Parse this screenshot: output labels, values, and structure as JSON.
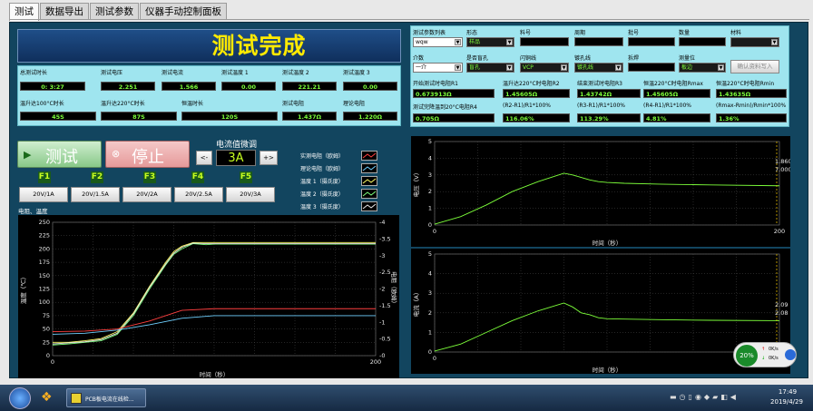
{
  "tabs": [
    "测试",
    "数据导出",
    "测试参数",
    "仪器手动控制面板"
  ],
  "banner": "测试完成",
  "params": {
    "labels": [
      "总测试时长",
      "测试电压",
      "测试电流",
      "测试温度 1",
      "测试温度 2",
      "测试温度 3"
    ],
    "values": [
      "0: 3:27",
      "2.251",
      "1.566",
      "0.00",
      "221.21",
      "0.00"
    ],
    "labels2": [
      "温升达100°C时长",
      "温升达220°C时长",
      "恒温时长",
      "测试电阻",
      "理论电阻"
    ],
    "values2": [
      "45S",
      "87S",
      "120S",
      "1.437Ω",
      "1.220Ω"
    ]
  },
  "right_panel": {
    "row1_labels": [
      "测试参数列表",
      "形态",
      "料号",
      "周期",
      "批号",
      "数量",
      "材料"
    ],
    "row1_values": [
      "wqw",
      "样品",
      "",
      "",
      "",
      "",
      ""
    ],
    "row2_labels": [
      "介数",
      "是否盲孔",
      "闪铜线",
      "镀孔线",
      "拆焊",
      "测量位"
    ],
    "row2_values": [
      "一介",
      "盲孔",
      "VCP",
      "镀孔线",
      "",
      "板边"
    ],
    "confirm_button": "确认资料写入",
    "row3_labels": [
      "开始测试时电阻R1",
      "温升达220°C时电阻R2",
      "结束测试时电阻R3",
      "恒温220°C时电阻Rmax",
      "恒温220°C时电阻Rmin"
    ],
    "row3_values": [
      "0.673913Ω",
      "1.45605Ω",
      "1.43742Ω",
      "1.45605Ω",
      "1.43635Ω"
    ],
    "row4_labels": [
      "测试完降温到20°C电阻R4",
      "(R2-R1)/R1*100%",
      "(R3-R1)/R1*100%",
      "(R4-R1)/R1*100%",
      "(Rmax-Rmin)/Rmin*100%"
    ],
    "row4_values": [
      "0.705Ω",
      "116.06%",
      "113.29%",
      "4.81%",
      "1.36%"
    ]
  },
  "controls": {
    "test_button": "测试",
    "stop_button": "停止",
    "current_adjust_label": "电流值微调",
    "current_minus": "<-",
    "current_value": "3A",
    "current_plus": "+>",
    "fkeys": [
      "F1",
      "F2",
      "F3",
      "F4",
      "F5"
    ],
    "presets": [
      "20V/1A",
      "20V/1.5A",
      "20V/2A",
      "20V/2.5A",
      "20V/3A"
    ]
  },
  "legend": [
    "实测电阻（欧姆）",
    "理论电阻（欧姆）",
    "温度 1（摄氏度）",
    "温度 2（摄氏度）",
    "温度 3（摄氏度）"
  ],
  "chart_main": {
    "title": "电阻、温度",
    "ylabel_left": "温度（℃）",
    "ylabel_right": "电阻（欧姆）",
    "xlabel": "时间（秒）",
    "left_ticks": [
      "250",
      "225",
      "200",
      "175",
      "150",
      "125",
      "100",
      "75",
      "50",
      "25",
      "0"
    ],
    "right_ticks": [
      "4",
      "3.5",
      "3",
      "2.5",
      "2",
      "1.5",
      "1",
      "0.5",
      "0"
    ],
    "x_ticks": [
      "0",
      "200"
    ]
  },
  "chart_voltage": {
    "ylabel": "电压（V）",
    "xlabel": "时间（秒）",
    "y_ticks": [
      "5",
      "4",
      "3",
      "2",
      "1",
      "0"
    ],
    "x_ticks": [
      "0",
      "200"
    ],
    "cursor_values": [
      "1.860",
      "7.000"
    ]
  },
  "chart_current": {
    "ylabel": "电流（A）",
    "xlabel": "时间（秒）",
    "y_ticks": [
      "5",
      "4",
      "3",
      "2",
      "1",
      "0"
    ],
    "x_ticks": [
      "0",
      "200"
    ],
    "cursor_values": [
      "2.09",
      "2.08"
    ]
  },
  "gauge": {
    "percent": "20%",
    "up": "0K/s",
    "down": "0K/s"
  },
  "taskbar": {
    "app_label": "PCB板电流在线检...",
    "time": "17:49",
    "date": "2019/4/29"
  },
  "chart_data": [
    {
      "type": "line",
      "title": "电阻、温度",
      "xlabel": "时间（秒）",
      "ylabel": "温度（℃）",
      "xlim": [
        0,
        200
      ],
      "ylim": [
        0,
        250
      ],
      "series": [
        {
          "name": "温度 1（摄氏度）",
          "color": "#ffff66",
          "x": [
            0,
            10,
            20,
            30,
            40,
            50,
            60,
            70,
            75,
            80,
            87,
            95,
            100,
            130,
            160,
            200
          ],
          "y": [
            25,
            25,
            28,
            32,
            45,
            80,
            130,
            175,
            195,
            205,
            212,
            212,
            212,
            212,
            212,
            212
          ]
        },
        {
          "name": "温度 2（摄氏度）",
          "color": "#7dff7d",
          "x": [
            0,
            10,
            20,
            30,
            40,
            50,
            60,
            70,
            75,
            80,
            87,
            95,
            100,
            130,
            160,
            200
          ],
          "y": [
            20,
            22,
            25,
            28,
            40,
            75,
            125,
            170,
            190,
            200,
            210,
            208,
            209,
            209,
            209,
            209
          ]
        },
        {
          "name": "温度 3（摄氏度）",
          "color": "#e8e8e8",
          "x": [
            0,
            10,
            20,
            30,
            40,
            50,
            60,
            70,
            75,
            80,
            87,
            95,
            100,
            130,
            160,
            200
          ],
          "y": [
            22,
            24,
            26,
            30,
            42,
            78,
            128,
            172,
            192,
            203,
            211,
            210,
            210,
            210,
            210,
            210
          ]
        },
        {
          "name": "实测电阻（欧姆）",
          "color": "#ff4040",
          "x": [
            0,
            20,
            40,
            60,
            80,
            100,
            130,
            160,
            200
          ],
          "y": [
            45,
            46,
            50,
            65,
            85,
            88,
            88,
            88,
            88
          ]
        },
        {
          "name": "理论电阻（欧姆）",
          "color": "#6fd0ff",
          "x": [
            0,
            20,
            40,
            60,
            80,
            100,
            130,
            160,
            200
          ],
          "y": [
            40,
            42,
            48,
            58,
            70,
            75,
            75,
            75,
            75
          ]
        }
      ]
    },
    {
      "type": "line",
      "xlabel": "时间（秒）",
      "ylabel": "电压（V）",
      "xlim": [
        0,
        200
      ],
      "ylim": [
        0,
        5
      ],
      "series": [
        {
          "color": "#7dff3a",
          "x": [
            0,
            15,
            30,
            45,
            60,
            75,
            80,
            85,
            90,
            95,
            100,
            110,
            130,
            160,
            200
          ],
          "y": [
            0.05,
            0.5,
            1.2,
            2.0,
            2.6,
            3.1,
            3.0,
            2.85,
            2.7,
            2.6,
            2.55,
            2.5,
            2.45,
            2.4,
            2.35
          ]
        }
      ]
    },
    {
      "type": "line",
      "xlabel": "时间（秒）",
      "ylabel": "电流（A）",
      "xlim": [
        0,
        200
      ],
      "ylim": [
        0,
        5
      ],
      "series": [
        {
          "color": "#7dff3a",
          "x": [
            0,
            15,
            30,
            45,
            60,
            75,
            80,
            85,
            90,
            95,
            100,
            110,
            130,
            160,
            200
          ],
          "y": [
            0.05,
            0.4,
            1.0,
            1.6,
            2.1,
            2.5,
            2.3,
            2.0,
            1.9,
            1.75,
            1.7,
            1.68,
            1.65,
            1.62,
            1.6
          ]
        }
      ]
    }
  ]
}
